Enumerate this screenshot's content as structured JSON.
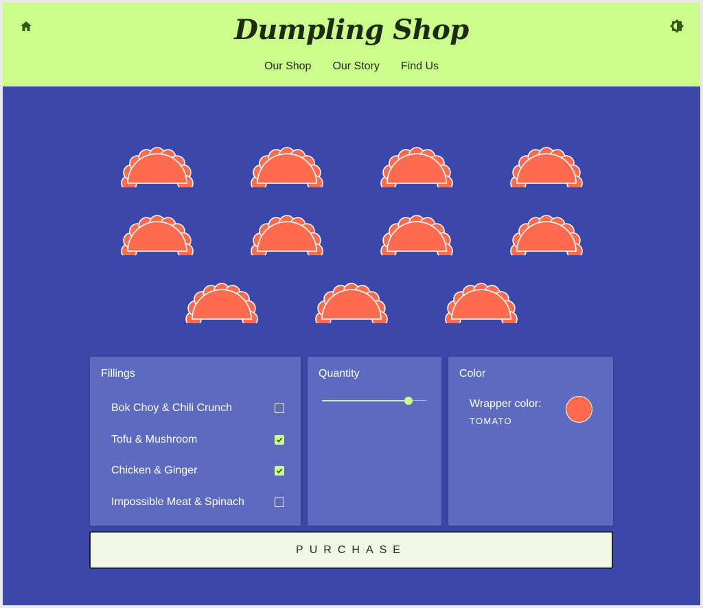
{
  "header": {
    "title": "Dumpling Shop",
    "home_icon": "home-icon",
    "theme_icon": "brightness-icon",
    "nav": [
      "Our Shop",
      "Our Story",
      "Find Us"
    ]
  },
  "colors": {
    "header_bg": "#ccfd8c",
    "page_bg": "#3b48a9",
    "panel_bg": "#5c6ac0",
    "wrapper": "#ff6b4e",
    "accent": "#ccfd8c"
  },
  "dumpling_count": 11,
  "fillings": {
    "title": "Fillings",
    "items": [
      {
        "label": "Bok Choy & Chili Crunch",
        "checked": false
      },
      {
        "label": "Tofu & Mushroom",
        "checked": true
      },
      {
        "label": "Chicken & Ginger",
        "checked": true
      },
      {
        "label": "Impossible Meat & Spinach",
        "checked": false
      }
    ]
  },
  "quantity": {
    "title": "Quantity",
    "value": 11,
    "fraction": 0.83
  },
  "color": {
    "title": "Color",
    "label": "Wrapper color:",
    "value": "TOMATO",
    "swatch": "#ff6b4e"
  },
  "purchase_label": "PURCHASE"
}
